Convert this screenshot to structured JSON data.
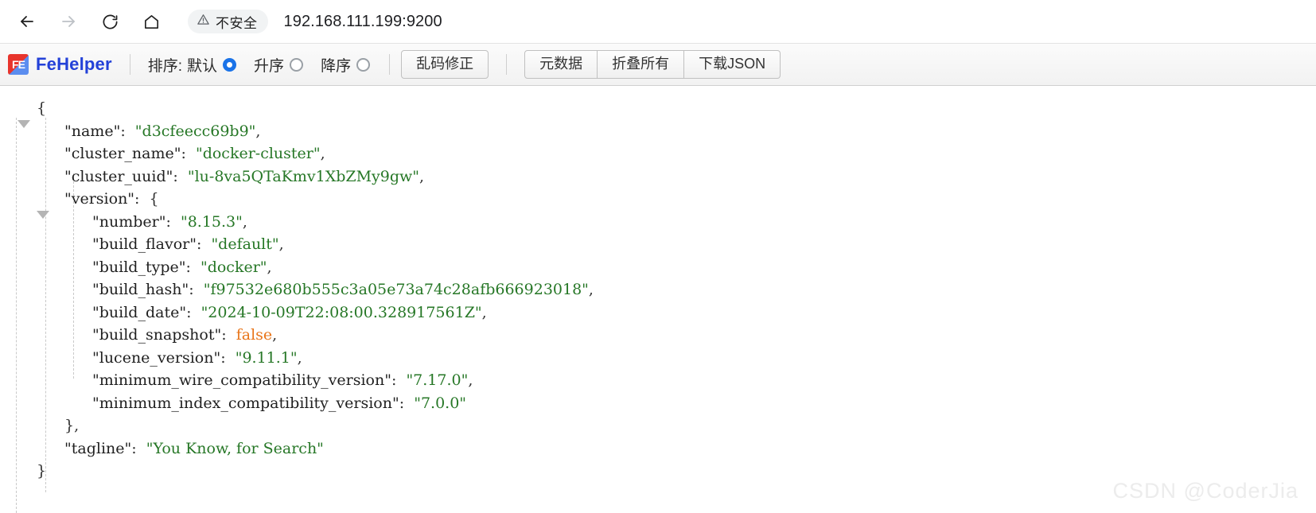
{
  "browser": {
    "back_icon": "arrow-left-icon",
    "forward_icon": "arrow-right-icon",
    "reload_icon": "reload-icon",
    "home_icon": "home-icon",
    "security_icon": "warning-triangle-icon",
    "security_label": "不安全",
    "url": "192.168.111.199:9200"
  },
  "toolbar": {
    "logo_mark": "FE",
    "logo_text": "FeHelper",
    "sort_label": "排序:",
    "sort_options": [
      {
        "label": "默认",
        "checked": true
      },
      {
        "label": "升序",
        "checked": false
      },
      {
        "label": "降序",
        "checked": false
      }
    ],
    "fix_encoding_label": "乱码修正",
    "actions": [
      {
        "label": "元数据"
      },
      {
        "label": "折叠所有"
      },
      {
        "label": "下载JSON"
      }
    ]
  },
  "watermark": "CSDN @CoderJia",
  "colors": {
    "brand": "#2341d8",
    "string": "#267726",
    "boolean": "#e8751a",
    "key": "#1f1f1f",
    "accent_radio": "#1a73e8"
  },
  "json": {
    "lines": [
      {
        "indent": 0,
        "twisty": "open",
        "text": "{"
      },
      {
        "indent": 1,
        "key": "name",
        "value": "\"d3cfeecc69b9\"",
        "type": "string",
        "comma": true
      },
      {
        "indent": 1,
        "key": "cluster_name",
        "value": "\"docker-cluster\"",
        "type": "string",
        "comma": true
      },
      {
        "indent": 1,
        "key": "cluster_uuid",
        "value": "\"lu-8va5QTaKmv1XbZMy9gw\"",
        "type": "string",
        "comma": true
      },
      {
        "indent": 1,
        "twisty": "open",
        "key": "version",
        "value": "{",
        "type": "punct",
        "comma": false
      },
      {
        "indent": 2,
        "key": "number",
        "value": "\"8.15.3\"",
        "type": "string",
        "comma": true
      },
      {
        "indent": 2,
        "key": "build_flavor",
        "value": "\"default\"",
        "type": "string",
        "comma": true
      },
      {
        "indent": 2,
        "key": "build_type",
        "value": "\"docker\"",
        "type": "string",
        "comma": true
      },
      {
        "indent": 2,
        "key": "build_hash",
        "value": "\"f97532e680b555c3a05e73a74c28afb666923018\"",
        "type": "string",
        "comma": true
      },
      {
        "indent": 2,
        "key": "build_date",
        "value": "\"2024-10-09T22:08:00.328917561Z\"",
        "type": "string",
        "comma": true
      },
      {
        "indent": 2,
        "key": "build_snapshot",
        "value": "false",
        "type": "boolean",
        "comma": true
      },
      {
        "indent": 2,
        "key": "lucene_version",
        "value": "\"9.11.1\"",
        "type": "string",
        "comma": true
      },
      {
        "indent": 2,
        "key": "minimum_wire_compatibility_version",
        "value": "\"7.17.0\"",
        "type": "string",
        "comma": true
      },
      {
        "indent": 2,
        "key": "minimum_index_compatibility_version",
        "value": "\"7.0.0\"",
        "type": "string",
        "comma": false
      },
      {
        "indent": 1,
        "text": "},"
      },
      {
        "indent": 1,
        "key": "tagline",
        "value": "\"You Know, for Search\"",
        "type": "string",
        "comma": false
      },
      {
        "indent": 0,
        "text": "}"
      }
    ]
  }
}
